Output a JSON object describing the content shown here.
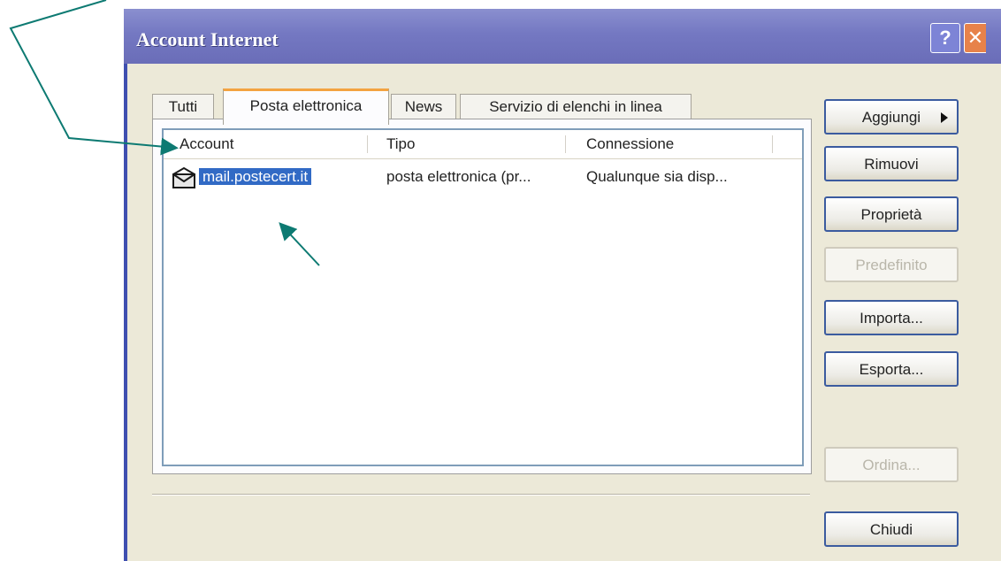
{
  "window": {
    "title": "Account Internet",
    "help_button": "?",
    "close_button": "✕"
  },
  "tabs": [
    {
      "label": "Tutti",
      "active": false
    },
    {
      "label": "Posta elettronica",
      "active": true
    },
    {
      "label": "News",
      "active": false
    },
    {
      "label": "Servizio di elenchi in linea",
      "active": false
    }
  ],
  "list": {
    "columns": [
      "Account",
      "Tipo",
      "Connessione"
    ],
    "rows": [
      {
        "account": "mail.postecert.it",
        "tipo": "posta elettronica (pr...",
        "connessione": "Qualunque sia disp...",
        "selected": true,
        "icon": "mail-account-icon"
      }
    ]
  },
  "buttons": {
    "aggiungi": "Aggiungi",
    "rimuovi": "Rimuovi",
    "proprieta": "Proprietà",
    "predefinito": "Predefinito",
    "importa": "Importa...",
    "esporta": "Esporta...",
    "ordina": "Ordina...",
    "chiudi": "Chiudi"
  },
  "colors": {
    "title_bar": "#7478c2",
    "selection": "#316ac5",
    "annotation_arrow": "#0d7a72"
  }
}
